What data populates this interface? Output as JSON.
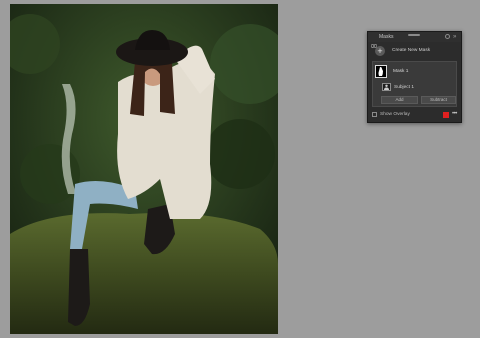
{
  "photo": {
    "alt_subject": "woman-sitting-on-mossy-rock"
  },
  "panel": {
    "title": "Masks",
    "create_label": "Create New Mask",
    "mask_name": "Mask 1",
    "subject_label": "Subject 1",
    "add_label": "Add",
    "subtract_label": "Subtract",
    "overlay_label": "Show Overlay",
    "collapse_glyph": "»",
    "more_glyph": "•••",
    "plus_glyph": "+"
  },
  "colors": {
    "canvas_bg": "#9d9d9d",
    "panel_bg": "#2c2c2c",
    "overlay_color": "#e02020"
  }
}
